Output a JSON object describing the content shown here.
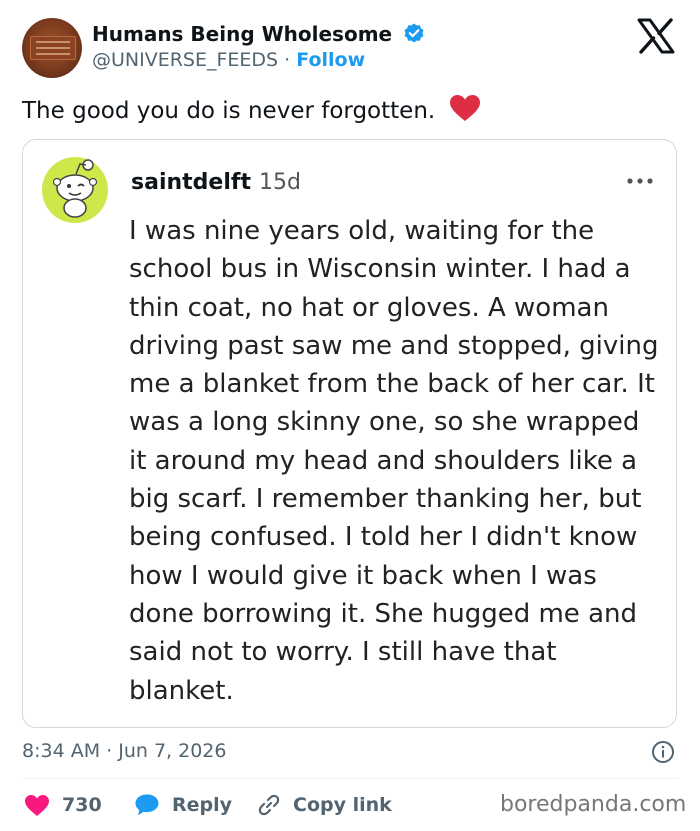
{
  "header": {
    "account_name": "Humans Being Wholesome",
    "handle": "@UNIVERSE_FEEDS",
    "separator": "·",
    "follow_label": "Follow",
    "avatar_icon": "avatar-image",
    "verified_icon": "verified-badge-icon",
    "close_icon": "x-logo-icon"
  },
  "tweet": {
    "text": "The good you do is never forgotten.",
    "emoji": "red-heart-icon"
  },
  "quoted_post": {
    "username": "saintdelft",
    "age": "15d",
    "more_icon": "more-options-icon",
    "body": "I was nine years old, waiting for the school bus in Wisconsin winter. I had a thin coat, no hat or gloves. A woman driving past saw me and stopped, giving me a blanket from the back of her car. It was a long skinny one, so she wrapped it around my head and shoulders like a big scarf. I remember thanking her, but being confused. I told her I didn't know how I would give it back when I was done borrowing it. She hugged me and said not to worry. I still have that blanket."
  },
  "footer": {
    "timestamp": "8:34 AM · Jun 7, 2026",
    "info_icon": "info-icon",
    "likes_count": "730",
    "reply_label": "Reply",
    "copy_link_label": "Copy link",
    "watermark": "boredpanda.com"
  },
  "colors": {
    "accent": "#1d9bf0",
    "like": "#f91880",
    "text": "#0f1419",
    "muted": "#536471",
    "border": "#cfd9de",
    "inner_avatar_bg": "#cde84a"
  }
}
